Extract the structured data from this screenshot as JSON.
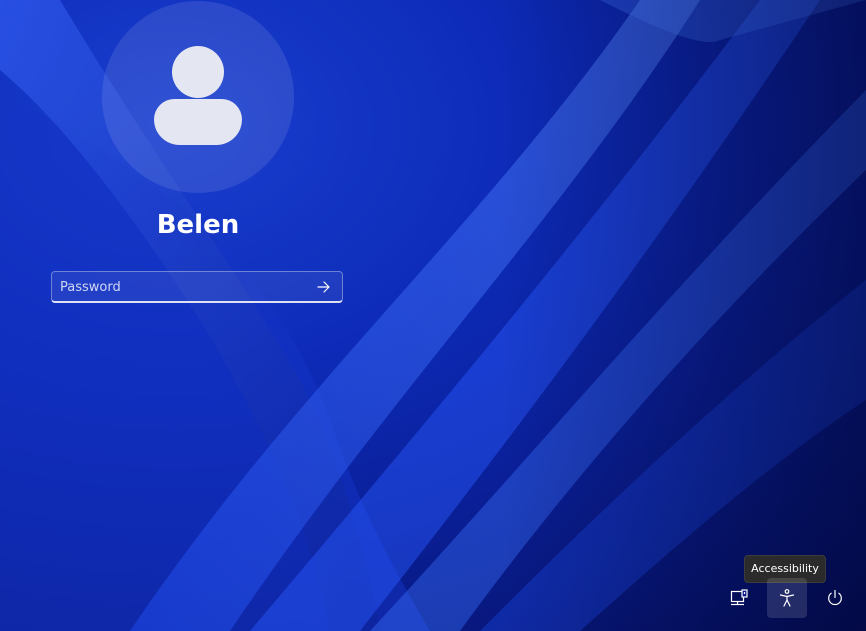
{
  "user": {
    "name": "Belen",
    "avatar_icon": "default-user-icon"
  },
  "password": {
    "placeholder": "Password",
    "value": "",
    "submit_icon": "arrow-right-icon"
  },
  "tooltip": {
    "text": "Accessibility"
  },
  "tray": {
    "buttons": [
      {
        "name": "network",
        "icon": "network-icon"
      },
      {
        "name": "accessibility",
        "icon": "accessibility-icon",
        "hovered": true
      },
      {
        "name": "power",
        "icon": "power-icon"
      }
    ]
  },
  "colors": {
    "wallpaper_base": "#0d2bb8",
    "wallpaper_dark": "#050e5a",
    "text": "#ffffff",
    "avatar_fill": "#e4e7f2",
    "tooltip_bg": "#2b2b2b"
  }
}
